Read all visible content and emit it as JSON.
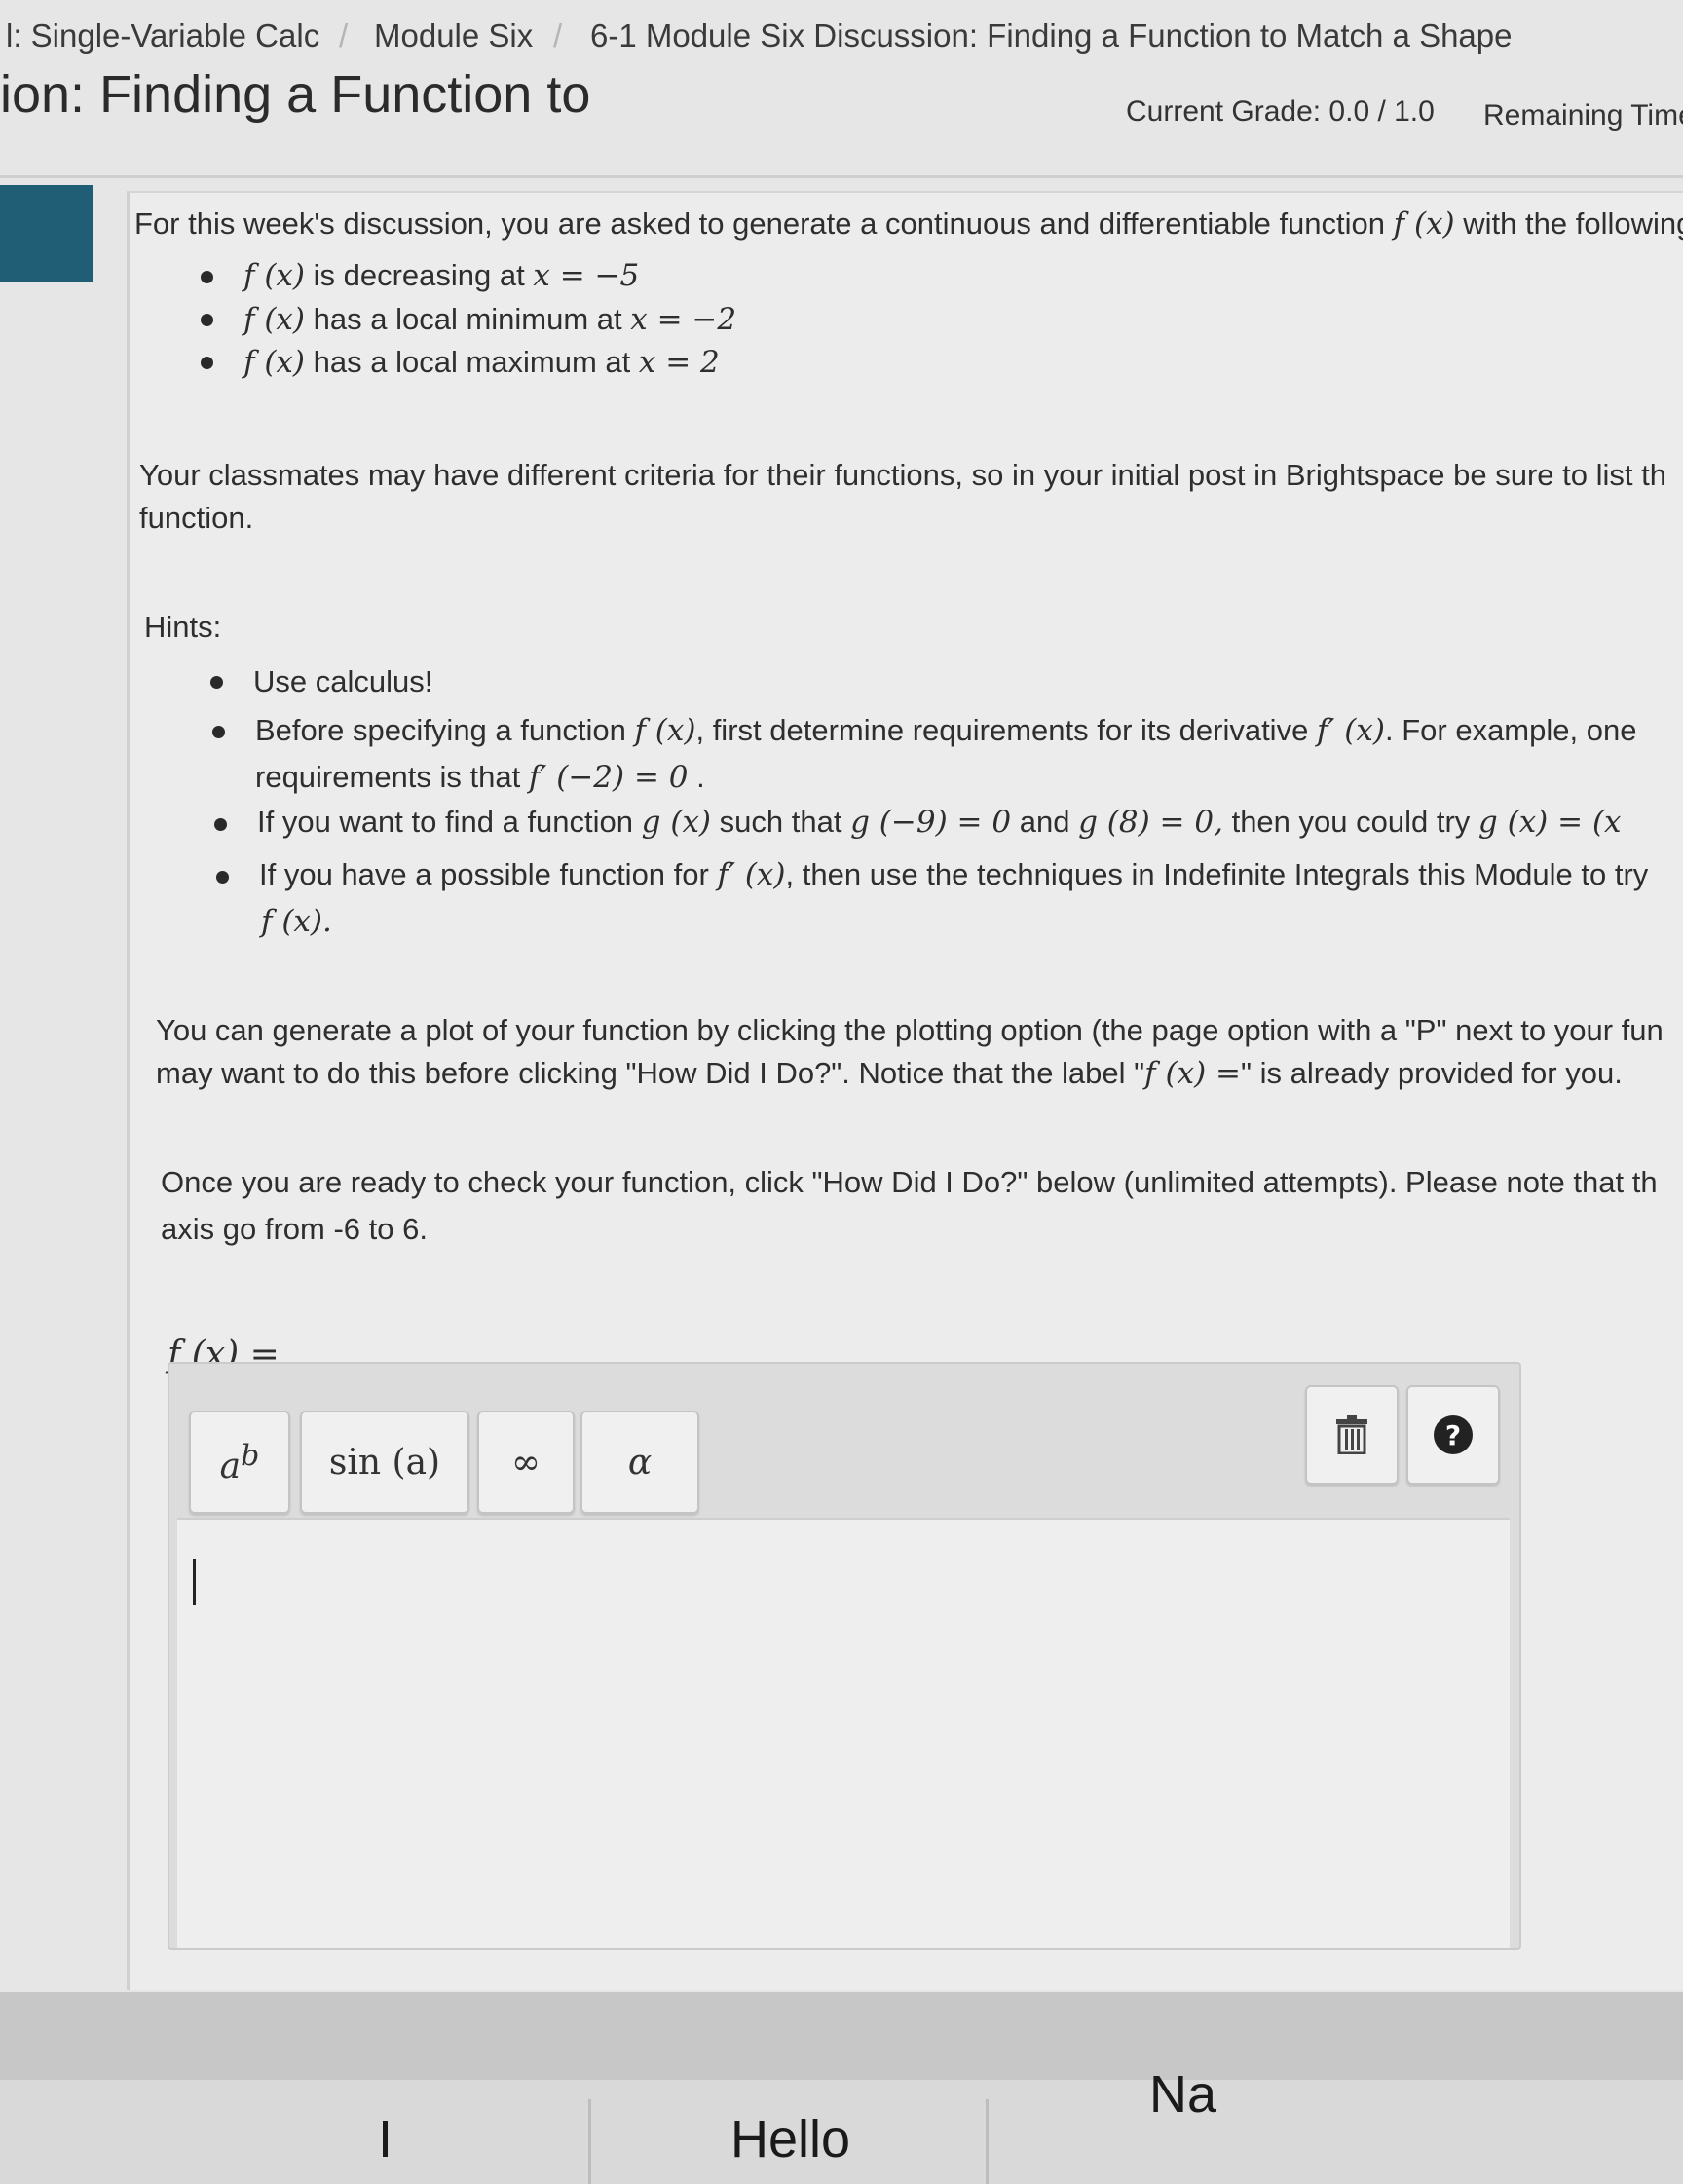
{
  "breadcrumb": {
    "course": "l: Single-Variable Calc",
    "module": "Module Six",
    "page": "6-1 Module Six Discussion: Finding a Function to Match a Shape",
    "separator": "/"
  },
  "header": {
    "title": "ion: Finding a Function to",
    "grade": "Current Grade: 0.0 / 1.0",
    "remaining": "Remaining Time"
  },
  "content": {
    "intro": "For this week's discussion, you are asked to generate a continuous and differentiable function",
    "intro_func": "f (x)",
    "intro_tail": "with the following",
    "criteria": [
      {
        "func": "f (x)",
        "text": "is decreasing at",
        "math": "x = −5"
      },
      {
        "func": "f (x)",
        "text": "has a local minimum at",
        "math": "x = −2"
      },
      {
        "func": "f (x)",
        "text": "has a local maximum at",
        "math": "x = 2"
      }
    ],
    "classmates_line1": "Your classmates may have different criteria for their functions, so in your initial post in Brightspace be sure to list th",
    "classmates_line2": "function.",
    "hints_label": "Hints:",
    "hint1": "Use calculus!",
    "hint2_a": "Before specifying a function",
    "hint2_func": "f (x)",
    "hint2_b": ", first determine requirements for its derivative",
    "hint2_deriv": "f′ (x)",
    "hint2_c": ". For example, one",
    "hint2_line2a": "requirements is that",
    "hint2_line2math": "f′ (−2) = 0",
    "hint2_line2end": ".",
    "hint3_a": "If you want to find a function",
    "hint3_func": "g (x)",
    "hint3_b": "such that",
    "hint3_m1": "g (−9) = 0",
    "hint3_c": "and",
    "hint3_m2": "g (8) = 0,",
    "hint3_d": "then you could try",
    "hint3_m3": "g (x) = (x",
    "hint4_a": "If you have a possible function for",
    "hint4_func": "f′ (x)",
    "hint4_b": ", then use the techniques in Indefinite Integrals this Module to try",
    "hint4_line2": "f (x).",
    "plot_line1": "You can generate a plot of your function by clicking the plotting option (the page option with a \"P\" next to your fun",
    "plot_line2a": "may want to do this before clicking \"How Did I Do?\". Notice that the label \"",
    "plot_line2math": "f (x) =",
    "plot_line2b": "\" is already provided for you.",
    "check_line1": "Once you are ready to check your function, click \"How Did I Do?\" below (unlimited attempts). Please note that th",
    "check_line2": "axis go from -6 to 6.",
    "answer_label": "f (x) ="
  },
  "editor": {
    "palette": [
      {
        "name": "exponent-button",
        "label": "a^b"
      },
      {
        "name": "sin-button",
        "label": "sin (a)"
      },
      {
        "name": "infinity-button",
        "label": "∞"
      },
      {
        "name": "alpha-button",
        "label": "α"
      }
    ],
    "trash_icon": "trash-icon",
    "help_icon": "help-icon",
    "help_glyph": "?",
    "input_value": ""
  },
  "keyboard": {
    "suggestions": [
      "I",
      "Hello",
      "Na"
    ]
  },
  "colors": {
    "accent_teal": "#1f5e74",
    "background": "#e6e6e6"
  }
}
